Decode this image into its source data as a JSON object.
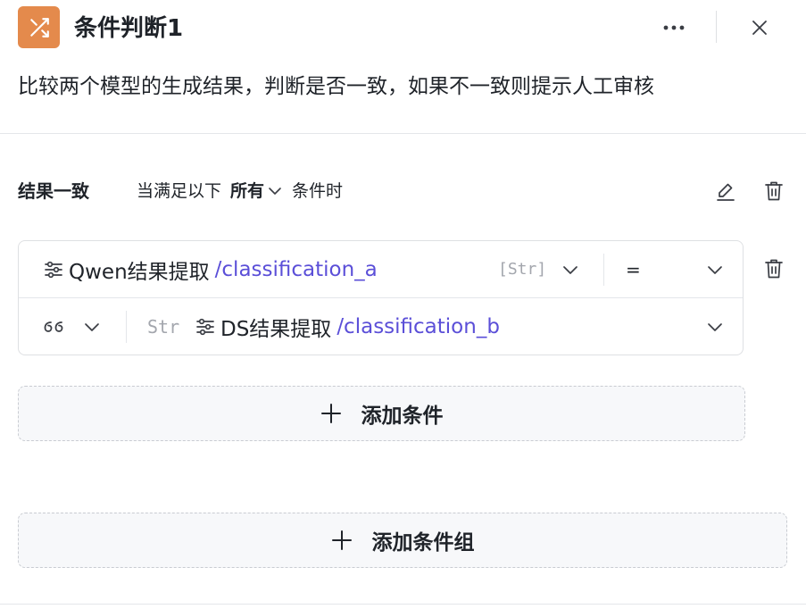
{
  "header": {
    "icon": "shuffle-icon",
    "title": "条件判断1",
    "description": "比较两个模型的生成结果，判断是否一致，如果不一致则提示人工审核",
    "more_icon": "more-dots-icon",
    "close_icon": "close-icon"
  },
  "branch": {
    "name": "结果一致",
    "rule_prefix": "当满足以下",
    "rule_match": "所有",
    "rule_suffix": "条件时",
    "edit_icon": "pencil-icon",
    "delete_icon": "trash-icon"
  },
  "condition": {
    "left": {
      "icon": "variable-sliders-icon",
      "node": "Qwen结果提取",
      "path": "/classification_a",
      "type": "[Str]"
    },
    "operator": "=",
    "right": {
      "mode_icon": "quote-icon",
      "type": "Str",
      "icon": "variable-sliders-icon",
      "node": "DS结果提取",
      "path": "/classification_b"
    },
    "delete_icon": "trash-icon"
  },
  "buttons": {
    "add_condition": "添加条件",
    "add_group": "添加条件组"
  },
  "colors": {
    "node_icon_bg": "#e48a4c",
    "variable_path": "#5b4fd8",
    "type_tag": "#a3a6ad",
    "dashed_border": "#c9ccd2"
  }
}
